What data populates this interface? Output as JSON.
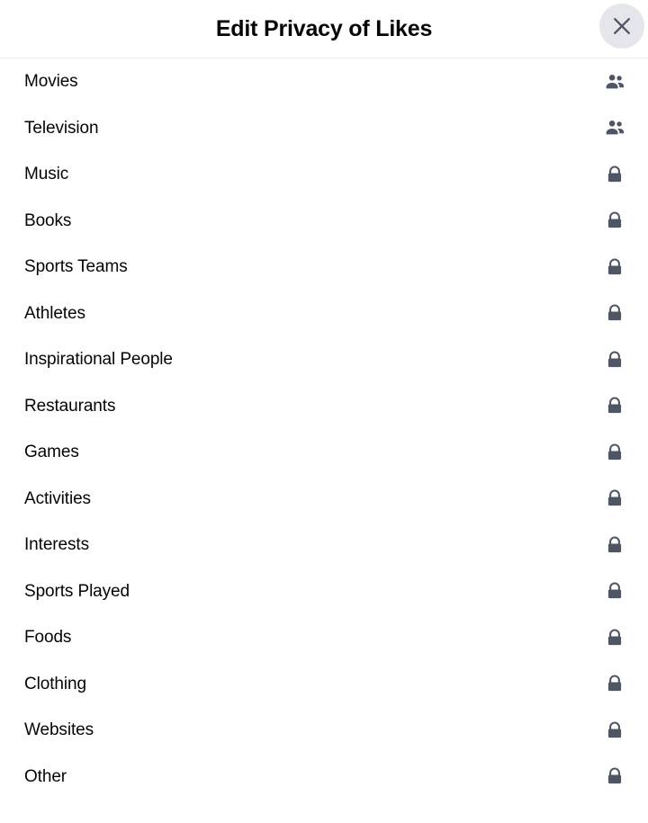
{
  "header": {
    "title": "Edit Privacy of Likes",
    "close_label": "Close",
    "close_icon": "close-icon"
  },
  "colors": {
    "icon": "#4e5665",
    "text": "#050505",
    "close_bg": "#e4e6eb",
    "divider": "#e8eaed",
    "background": "#ffffff"
  },
  "list": {
    "items": [
      {
        "label": "Movies",
        "privacy_icon": "friends-icon"
      },
      {
        "label": "Television",
        "privacy_icon": "friends-icon"
      },
      {
        "label": "Music",
        "privacy_icon": "lock-icon"
      },
      {
        "label": "Books",
        "privacy_icon": "lock-icon"
      },
      {
        "label": "Sports Teams",
        "privacy_icon": "lock-icon"
      },
      {
        "label": "Athletes",
        "privacy_icon": "lock-icon"
      },
      {
        "label": "Inspirational People",
        "privacy_icon": "lock-icon"
      },
      {
        "label": "Restaurants",
        "privacy_icon": "lock-icon"
      },
      {
        "label": "Games",
        "privacy_icon": "lock-icon"
      },
      {
        "label": "Activities",
        "privacy_icon": "lock-icon"
      },
      {
        "label": "Interests",
        "privacy_icon": "lock-icon"
      },
      {
        "label": "Sports Played",
        "privacy_icon": "lock-icon"
      },
      {
        "label": "Foods",
        "privacy_icon": "lock-icon"
      },
      {
        "label": "Clothing",
        "privacy_icon": "lock-icon"
      },
      {
        "label": "Websites",
        "privacy_icon": "lock-icon"
      },
      {
        "label": "Other",
        "privacy_icon": "lock-icon"
      }
    ]
  }
}
